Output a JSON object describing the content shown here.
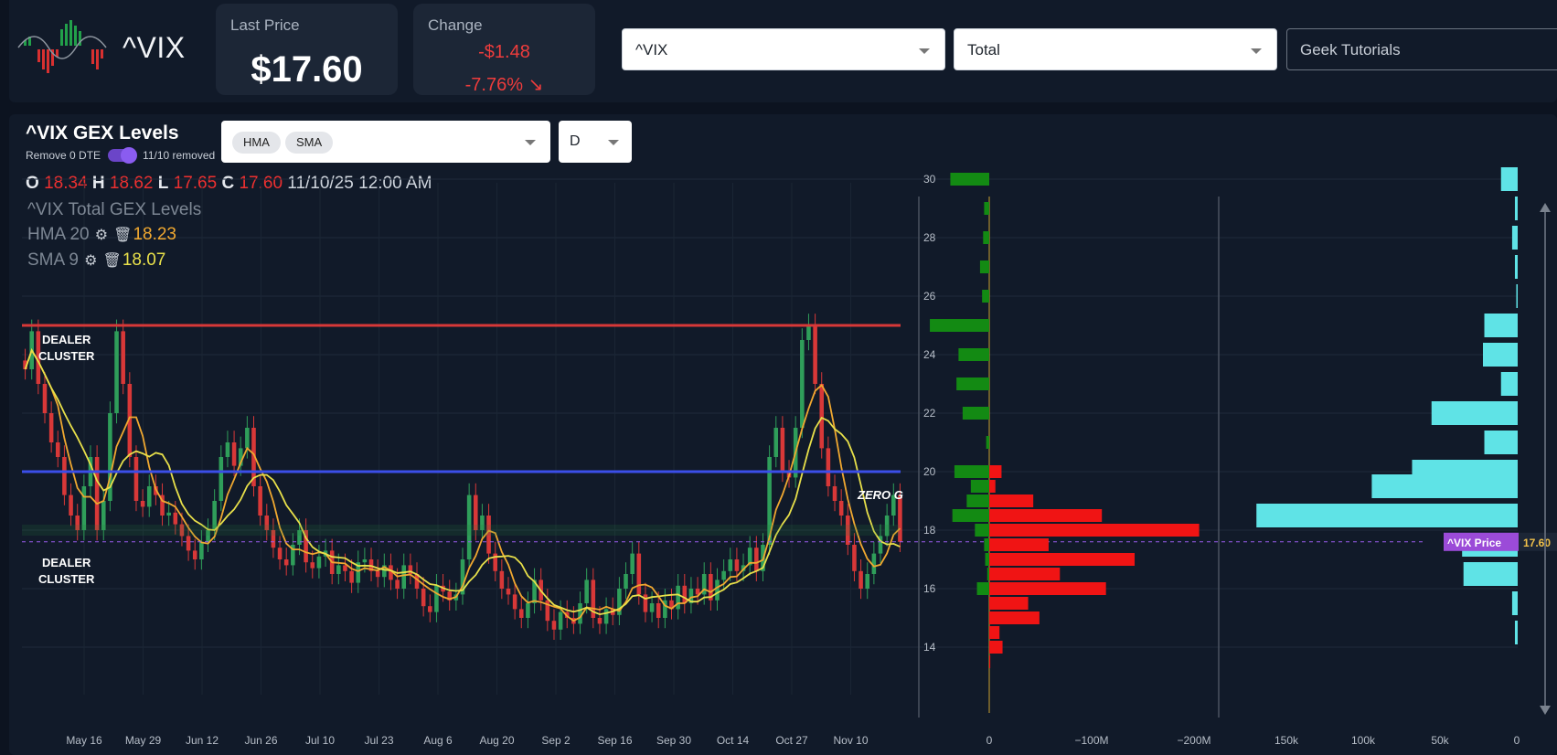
{
  "header": {
    "ticker": "^VIX",
    "last_price_label": "Last Price",
    "last_price": "$17.60",
    "change_label": "Change",
    "change_abs": "-$1.48",
    "change_pct": "-7.76%",
    "select_ticker": "^VIX",
    "select_total": "Total",
    "select_tutorials": "Geek Tutorials",
    "colors": {
      "down": "#ee3c3c",
      "up": "#22a04a"
    }
  },
  "panel": {
    "title": "^VIX GEX Levels",
    "toggle_label": "Remove 0 DTE",
    "toggle_state": "11/10 removed",
    "indicator_chips": [
      "HMA",
      "SMA"
    ],
    "period": "D",
    "ohlc": {
      "o_label": "O",
      "o": "18.34",
      "h_label": "H",
      "h": "18.62",
      "l_label": "L",
      "l": "17.65",
      "c_label": "C",
      "c": "17.60",
      "datetime": "11/10/25 12:00 AM"
    },
    "legend": {
      "title": "^VIX Total GEX Levels",
      "hma_label": "HMA",
      "hma_period": "20",
      "hma_value": "18.23",
      "sma_label": "SMA",
      "sma_period": "9",
      "sma_value": "18.07"
    },
    "annotations": {
      "dealer_cluster_top": "DEALER CLUSTER",
      "dealer_cluster_bottom": "DEALER CLUSTER",
      "zero_g": "ZERO G"
    },
    "price_tag": {
      "label": "^VIX Price",
      "value": "17.60"
    }
  },
  "chart_data": {
    "type": "candlestick+bar",
    "y_axis_ticks": [
      "30",
      "28",
      "26",
      "24",
      "22",
      "20",
      "18",
      "16",
      "14"
    ],
    "ylim": [
      13,
      30.5
    ],
    "x_axis_ticks": [
      "May 16",
      "May 29",
      "Jun 12",
      "Jun 26",
      "Jul 10",
      "Jul 23",
      "Aug 6",
      "Aug 20",
      "Sep 2",
      "Sep 16",
      "Sep 30",
      "Oct 14",
      "Oct 27",
      "Nov 10"
    ],
    "levels": {
      "dealer_cluster_top": 25.0,
      "zero_g": 20.0,
      "dealer_cluster_bottom": 18.0,
      "price": 17.6
    },
    "candles_close": [
      23.5,
      24.8,
      23.0,
      22.0,
      21.0,
      20.5,
      19.2,
      18.5,
      18.0,
      19.5,
      20.5,
      18.0,
      19.0,
      22.0,
      24.8,
      23.0,
      20.5,
      19.0,
      18.8,
      19.5,
      19.2,
      18.5,
      18.6,
      18.2,
      17.8,
      17.3,
      17.0,
      17.6,
      18.0,
      19.0,
      20.5,
      21.0,
      20.2,
      20.8,
      21.5,
      19.5,
      18.5,
      18.0,
      17.4,
      17.0,
      16.8,
      17.5,
      18.0,
      16.9,
      16.7,
      17.1,
      17.3,
      16.5,
      16.8,
      16.6,
      16.2,
      16.9,
      17.0,
      16.6,
      16.4,
      16.8,
      16.3,
      16.0,
      16.8,
      16.5,
      16.0,
      15.4,
      15.2,
      16.1,
      15.9,
      15.6,
      15.8,
      17.0,
      19.2,
      18.0,
      18.5,
      17.2,
      16.6,
      16.0,
      15.8,
      15.3,
      15.0,
      15.5,
      16.3,
      15.6,
      14.9,
      14.6,
      15.2,
      15.0,
      14.8,
      15.5,
      16.3,
      15.0,
      14.8,
      15.3,
      15.1,
      16.0,
      16.5,
      17.2,
      15.8,
      15.2,
      15.5,
      15.0,
      15.6,
      15.3,
      16.1,
      15.5,
      16.0,
      15.8,
      16.5,
      15.6,
      16.3,
      16.6,
      17.0,
      16.6,
      16.8,
      17.4,
      16.6,
      17.5,
      20.5,
      21.5,
      20.0,
      19.8,
      21.5,
      24.5,
      25.0,
      23.0,
      20.8,
      19.5,
      19.0,
      18.5,
      17.5,
      16.6,
      16.0,
      16.5,
      17.2,
      17.8,
      18.5,
      19.2,
      17.6
    ],
    "gex_strikes": [
      30,
      29,
      28,
      27,
      26,
      25,
      24,
      23,
      22,
      21,
      20,
      19.5,
      19,
      18.5,
      18,
      17.5,
      17,
      16.5,
      16,
      15.5,
      15,
      14.5,
      14,
      13.5
    ],
    "gex_values_M": [
      -38,
      -5,
      -6,
      -9,
      -7,
      -58,
      -30,
      -32,
      -26,
      -3,
      -34,
      -18,
      -22,
      -36,
      -14,
      -5,
      -4,
      -2,
      -12,
      0,
      0,
      0,
      0,
      0
    ],
    "gex_put_values_M": [
      0,
      0,
      0,
      0,
      0,
      0,
      0,
      0,
      0,
      0,
      12,
      6,
      43,
      110,
      205,
      58,
      142,
      69,
      114,
      38,
      49,
      10,
      13,
      1
    ],
    "gex_x_ticks": [
      "0",
      "−100M",
      "−200M"
    ],
    "oi_values_k": [
      12,
      2,
      4,
      2,
      1,
      24,
      25,
      12,
      62,
      24,
      76,
      105,
      0,
      188,
      0,
      40,
      0,
      39,
      0,
      4,
      0,
      2,
      0,
      0
    ],
    "oi_x_ticks": [
      "150k",
      "100k",
      "50k",
      "0"
    ]
  }
}
